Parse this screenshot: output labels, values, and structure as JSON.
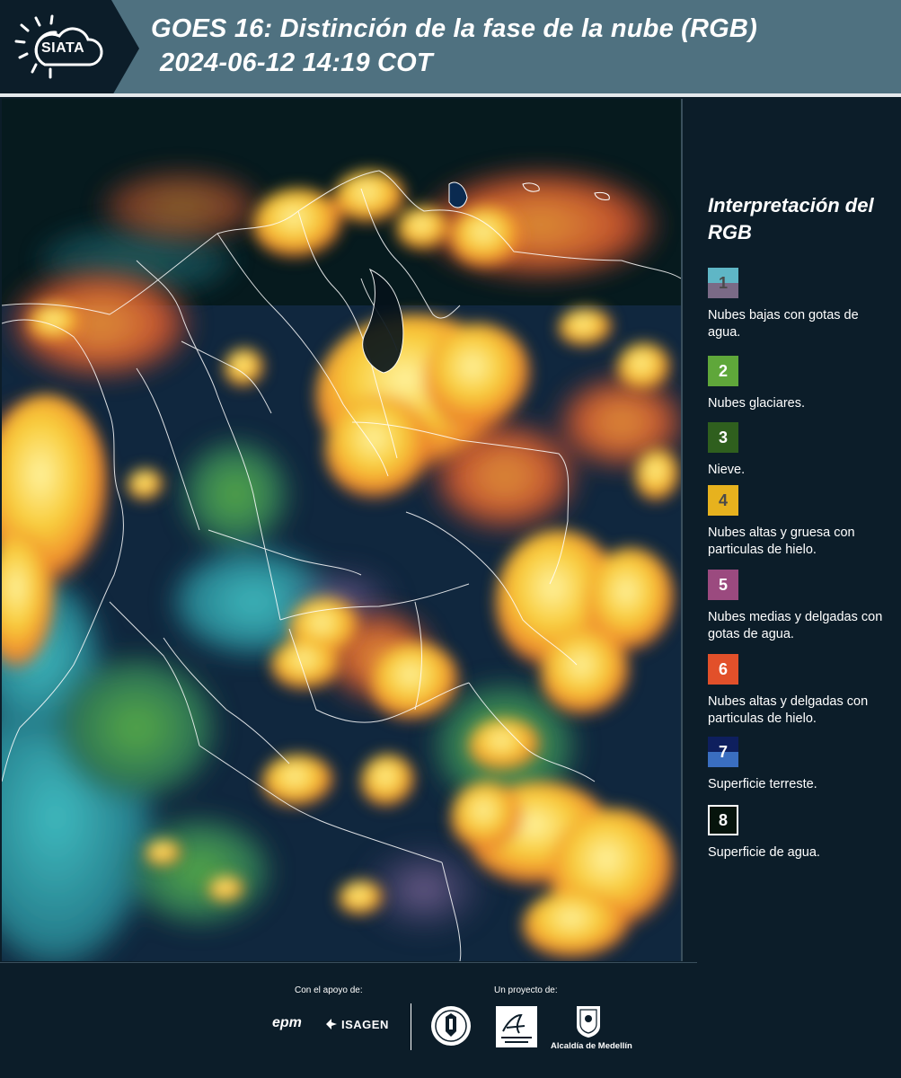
{
  "header": {
    "logo_text": "SIATA",
    "title_line1": "GOES 16: Distinción de la fase de la nube (RGB)",
    "title_line2": "2024-06-12 14:19 COT"
  },
  "legend": {
    "title": "Interpretación del RGB",
    "items": [
      {
        "number": "1",
        "label": "Nubes bajas con gotas de agua.",
        "color_top": "#5fb6c6",
        "color_bottom": "#7a6a86",
        "num_color": "#4a4a4a"
      },
      {
        "number": "2",
        "label": "Nubes glaciares.",
        "color": "#5fa73a",
        "num_color": "#ffffff"
      },
      {
        "number": "3",
        "label": "Nieve.",
        "color": "#2f5f1e",
        "num_color": "#ffffff"
      },
      {
        "number": "4",
        "label": "Nubes altas y gruesa con particulas de hielo.",
        "color": "#e7b21e",
        "num_color": "#4a4a4a"
      },
      {
        "number": "5",
        "label": "Nubes medias y delgadas con gotas de agua.",
        "color": "#9b4a7f",
        "num_color": "#ffffff"
      },
      {
        "number": "6",
        "label": "Nubes altas y delgadas con particulas de hielo.",
        "color": "#e2502a",
        "num_color": "#ffffff"
      },
      {
        "number": "7",
        "label": "Superficie terreste.",
        "color_top": "#0e1f5e",
        "color_bottom": "#3a6ec0",
        "num_color": "#ffffff"
      },
      {
        "number": "8",
        "label": "Superficie de agua.",
        "color": "#06140c",
        "num_color": "#ffffff",
        "border": "#ffffff"
      }
    ]
  },
  "footer": {
    "support_label": "Con el apoyo de:",
    "project_label": "Un proyecto de:",
    "epm": "epm",
    "isagen": "ISAGEN",
    "alcaldia": "Alcaldía de Medellín"
  }
}
